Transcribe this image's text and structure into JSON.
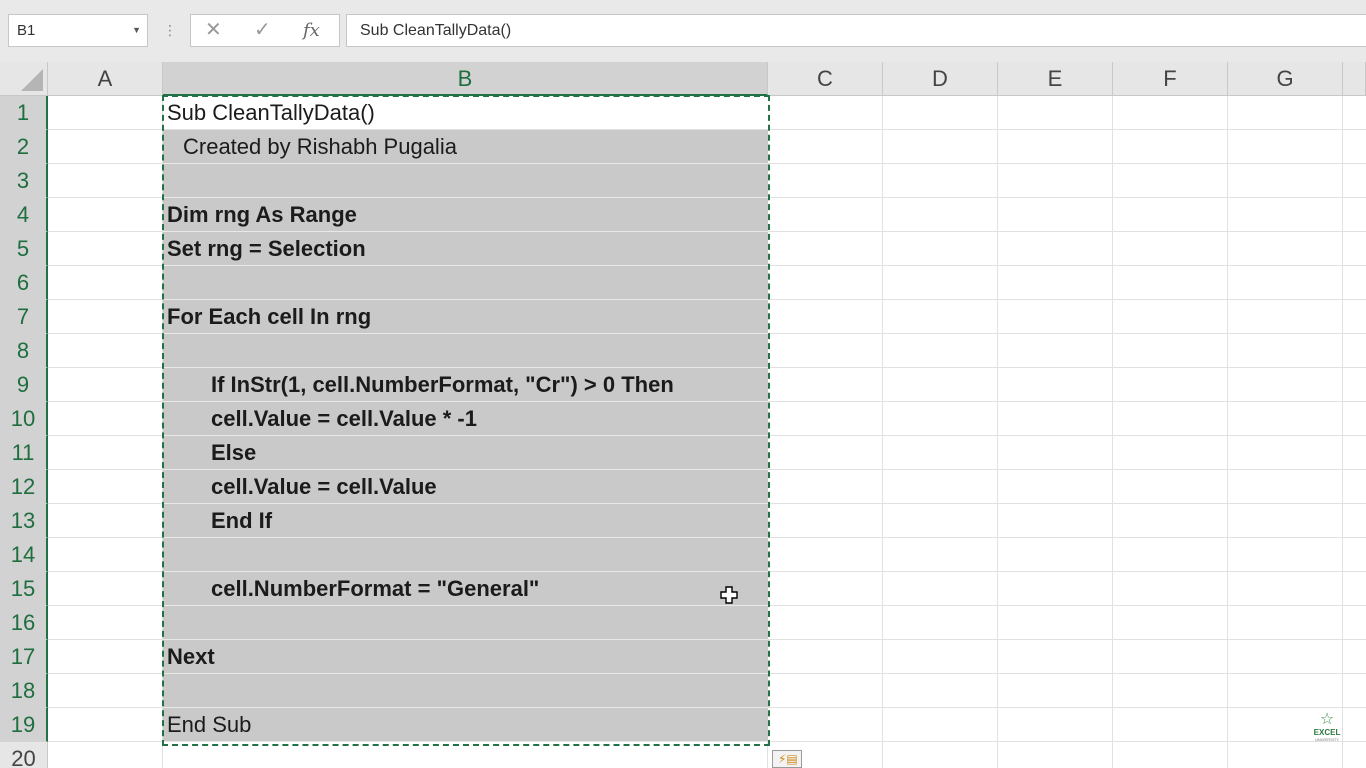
{
  "formula_bar": {
    "name_box": "B1",
    "cancel_icon": "close-icon",
    "enter_icon": "checkmark-icon",
    "fx_label": "fx",
    "formula": "Sub CleanTallyData()"
  },
  "columns": [
    "A",
    "B",
    "C",
    "D",
    "E",
    "F",
    "G"
  ],
  "selected_column": "B",
  "rows": [
    "1",
    "2",
    "3",
    "4",
    "5",
    "6",
    "7",
    "8",
    "9",
    "10",
    "11",
    "12",
    "13",
    "14",
    "15",
    "16",
    "17",
    "18",
    "19",
    "20"
  ],
  "cells_b": [
    "Sub CleanTallyData()",
    "Created by Rishabh Pugalia",
    "",
    "Dim rng As Range",
    "Set rng = Selection",
    "",
    "For Each cell In rng",
    "",
    "If InStr(1, cell.NumberFormat, \"Cr\") > 0 Then",
    "cell.Value = cell.Value * -1",
    "Else",
    "cell.Value = cell.Value",
    "End If",
    "",
    "cell.NumberFormat = \"General\"",
    "",
    "Next",
    "",
    "End Sub"
  ],
  "watermark": {
    "brand": "EXCEL",
    "tagline": "UNIVERSITY"
  },
  "colors": {
    "accent_green": "#217346",
    "selection_fill": "#c9c9c9",
    "header_fill": "#e6e6e6"
  }
}
